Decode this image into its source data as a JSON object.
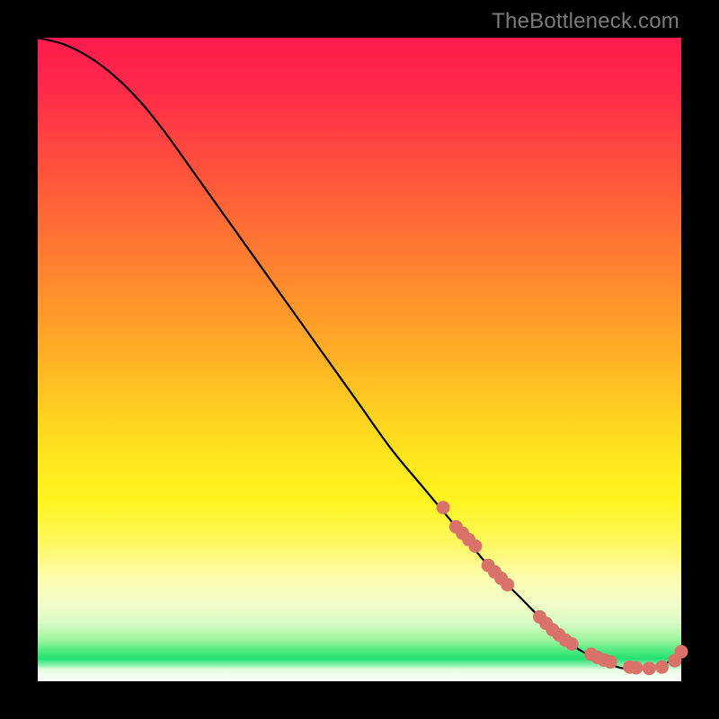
{
  "attribution": "TheBottleneck.com",
  "chart_data": {
    "type": "line",
    "title": "",
    "xlabel": "",
    "ylabel": "",
    "xlim": [
      0,
      100
    ],
    "ylim": [
      0,
      100
    ],
    "grid": false,
    "legend": false,
    "series": [
      {
        "name": "bottleneck-curve",
        "x": [
          0,
          4,
          8,
          12,
          16,
          20,
          25,
          30,
          35,
          40,
          45,
          50,
          55,
          60,
          65,
          70,
          75,
          80,
          84,
          88,
          91,
          94,
          96,
          98,
          100
        ],
        "y": [
          100,
          99,
          97,
          94,
          90,
          85,
          78,
          71,
          64,
          57,
          50,
          43,
          36,
          30,
          24,
          18,
          13,
          8,
          5,
          3,
          2,
          2,
          2,
          3,
          5
        ]
      }
    ],
    "markers": {
      "name": "highlighted-points",
      "color": "#d9736a",
      "x": [
        63,
        65,
        66,
        67,
        68,
        70,
        71,
        72,
        73,
        78,
        79,
        80,
        81,
        82,
        83,
        86,
        87,
        88,
        89,
        92,
        93,
        95,
        97,
        99,
        100
      ],
      "y": [
        27,
        24,
        23,
        22,
        21,
        18,
        17,
        16,
        15,
        10,
        9,
        8,
        7.2,
        6.4,
        5.8,
        4.2,
        3.7,
        3.3,
        3.0,
        2.2,
        2.1,
        2.0,
        2.2,
        3.2,
        4.6
      ]
    }
  }
}
